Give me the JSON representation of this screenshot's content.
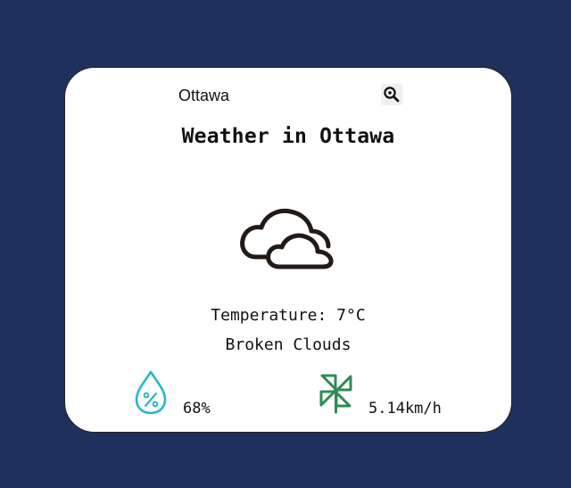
{
  "search": {
    "value": "Ottawa",
    "icon": "search-icon"
  },
  "title": "Weather in Ottawa",
  "weather": {
    "icon": "broken-clouds-icon",
    "temperature": "Temperature: 7°C",
    "description": "Broken Clouds"
  },
  "details": {
    "humidity": {
      "icon": "humidity-icon",
      "value": "68%"
    },
    "wind": {
      "icon": "wind-icon",
      "value": "5.14km/h"
    }
  },
  "colors": {
    "background": "#1f305e",
    "card": "#ffffff",
    "humidity_icon": "#2bb7c4",
    "wind_icon": "#2e8b57"
  }
}
